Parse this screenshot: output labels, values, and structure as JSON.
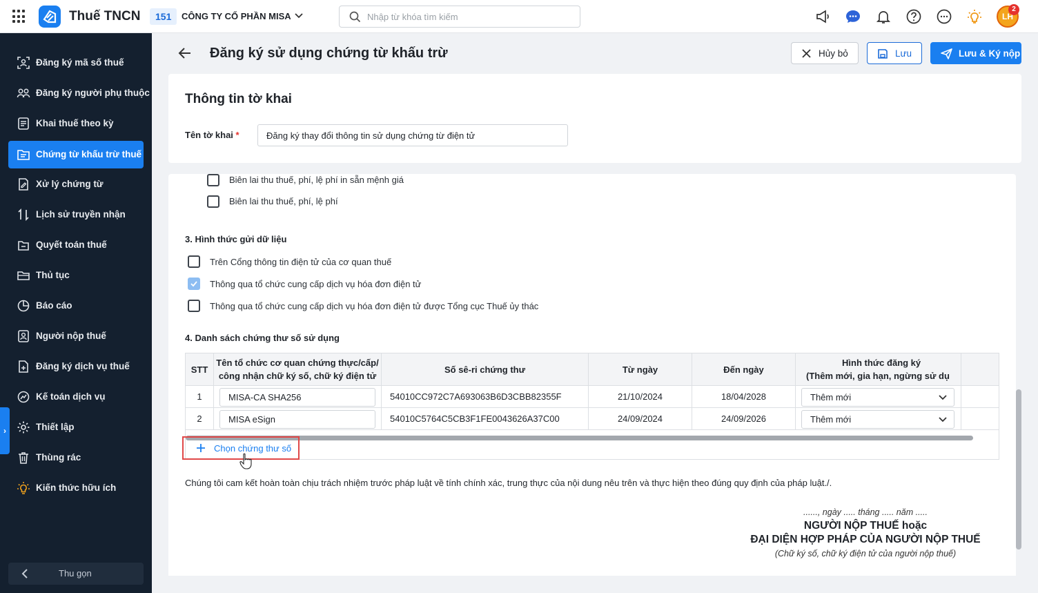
{
  "topbar": {
    "app_title": "Thuế TNCN",
    "org_code": "151",
    "org_name": "CÔNG TY CỔ PHẦN MISA",
    "search_placeholder": "Nhập từ khóa tìm kiếm",
    "avatar_initials": "LH",
    "notification_count": "2"
  },
  "sidebar": {
    "items": [
      {
        "label": "Đăng ký mã số thuế",
        "icon": "id-scan-icon"
      },
      {
        "label": "Đăng ký người phụ thuộc",
        "icon": "users-icon"
      },
      {
        "label": "Khai thuế theo kỳ",
        "icon": "document-icon"
      },
      {
        "label": "Chứng từ khấu trừ thuế",
        "icon": "folder-doc-icon"
      },
      {
        "label": "Xử lý chứng từ",
        "icon": "doc-edit-icon"
      },
      {
        "label": "Lịch sử truyền nhận",
        "icon": "transfer-icon"
      },
      {
        "label": "Quyết toán thuế",
        "icon": "settlement-icon"
      },
      {
        "label": "Thủ tục",
        "icon": "folder-icon"
      },
      {
        "label": "Báo cáo",
        "icon": "chart-icon"
      },
      {
        "label": "Người nộp thuế",
        "icon": "person-card-icon"
      },
      {
        "label": "Đăng ký dịch vụ thuế",
        "icon": "doc-add-icon"
      },
      {
        "label": "Kế toán dịch vụ",
        "icon": "accounting-icon"
      },
      {
        "label": "Thiết lập",
        "icon": "gear-icon"
      },
      {
        "label": "Thùng rác",
        "icon": "trash-icon"
      },
      {
        "label": "Kiến thức hữu ích",
        "icon": "lightbulb-icon"
      }
    ],
    "active_index": 3,
    "collapse_label": "Thu gọn"
  },
  "page": {
    "title": "Đăng ký sử dụng chứng từ khấu trừ",
    "cancel_label": "Hủy bỏ",
    "save_label": "Lưu",
    "submit_label": "Lưu & Ký nộp"
  },
  "info": {
    "title": "Thông tin tờ khai",
    "name_label": "Tên tờ khai",
    "required_mark": "*",
    "name_value": "Đăng ký thay đổi thông tin sử dụng chứng từ điện tử"
  },
  "receipt_options": [
    {
      "label": "Biên lai thu thuế, phí, lệ phí in sẵn mệnh giá",
      "checked": false
    },
    {
      "label": "Biên lai thu thuế, phí, lệ phí",
      "checked": false
    }
  ],
  "section3": {
    "title": "3. Hình thức gửi dữ liệu",
    "options": [
      {
        "label": "Trên Cổng thông tin điện tử của cơ quan thuế",
        "checked": false
      },
      {
        "label": "Thông qua tổ chức cung cấp dịch vụ hóa đơn điện tử",
        "checked": true
      },
      {
        "label": "Thông qua tổ chức cung cấp dịch vụ hóa đơn điện tử được Tổng cục Thuế ủy thác",
        "checked": false
      }
    ]
  },
  "section4": {
    "title": "4. Danh sách chứng thư số sử dụng",
    "headers": {
      "stt": "STT",
      "org_line1": "Tên tổ chức cơ quan chứng thực/cấp/",
      "org_line2": "công nhận chữ ký số, chữ ký điện tử",
      "serial": "Số sê-ri chứng thư",
      "from": "Từ ngày",
      "to": "Đến ngày",
      "reg_line1": "Hình thức đăng ký",
      "reg_line2": "(Thêm mới, gia hạn, ngừng sử dụ"
    },
    "rows": [
      {
        "stt": "1",
        "org": "MISA-CA SHA256",
        "serial": "54010CC972C7A693063B6D3CBB82355F",
        "from": "21/10/2024",
        "to": "18/04/2028",
        "reg": "Thêm mới"
      },
      {
        "stt": "2",
        "org": "MISA eSign",
        "serial": "54010C5764C5CB3F1FE0043626A37C00",
        "from": "24/09/2024",
        "to": "24/09/2026",
        "reg": "Thêm mới"
      }
    ],
    "add_label": "Chọn chứng thư số"
  },
  "commitment": "Chúng tôi cam kết hoàn toàn chịu trách nhiệm trước pháp luật về tính chính xác, trung thực của nội dung nêu trên và thực hiện theo đúng quy định của pháp luật./.",
  "signature": {
    "date_line": "......, ngày ..... tháng ..... năm .....",
    "line1": "NGƯỜI NỘP THUẾ hoặc",
    "line2": "ĐẠI DIỆN HỢP PHÁP CỦA NGƯỜI NỘP THUẾ",
    "note": "(Chữ ký số, chữ ký điện tử của người nộp thuế)"
  },
  "colors": {
    "accent": "#1a7ff0",
    "sidebar_bg": "#14202f",
    "highlight_box": "#e04848"
  }
}
